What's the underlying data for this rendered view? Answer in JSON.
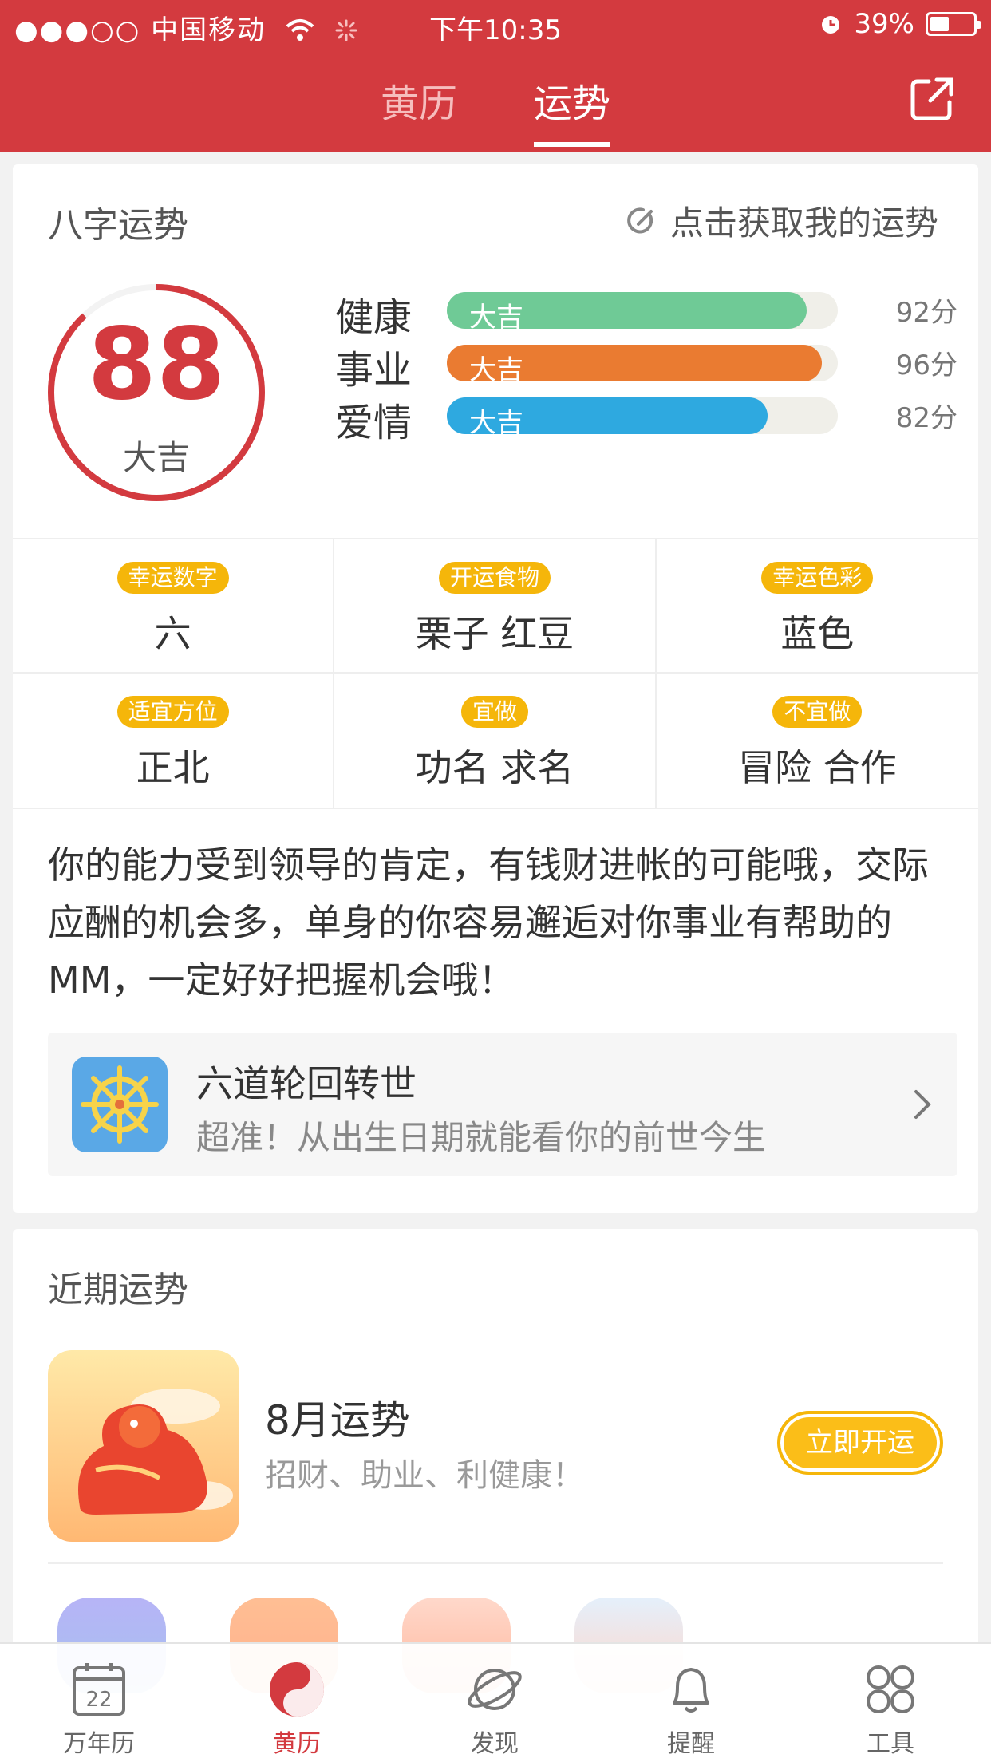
{
  "status_bar": {
    "signal": "●●●○○",
    "carrier": "中国移动",
    "time": "下午10:35",
    "battery": "39%",
    "battery_level": 0.39
  },
  "header": {
    "tabs": [
      {
        "label": "黄历",
        "active": false
      },
      {
        "label": "运势",
        "active": true
      }
    ]
  },
  "bazi": {
    "title": "八字运势",
    "get_label": "点击获取我的运势",
    "score": "88",
    "score_label": "大吉",
    "score_fraction": 0.88,
    "bars": [
      {
        "name": "健康",
        "tag": "大吉",
        "score": "92分",
        "value": 92,
        "color": "#6fca96"
      },
      {
        "name": "事业",
        "tag": "大吉",
        "score": "96分",
        "value": 96,
        "color": "#ea7b31"
      },
      {
        "name": "爱情",
        "tag": "大吉",
        "score": "82分",
        "value": 82,
        "color": "#2ea9e0"
      }
    ],
    "grid": [
      {
        "tag": "幸运数字",
        "value": "六"
      },
      {
        "tag": "开运食物",
        "value": "栗子 红豆"
      },
      {
        "tag": "幸运色彩",
        "value": "蓝色"
      },
      {
        "tag": "适宜方位",
        "value": "正北"
      },
      {
        "tag": "宜做",
        "value": "功名 求名"
      },
      {
        "tag": "不宜做",
        "value": "冒险 合作"
      }
    ],
    "description": "你的能力受到领导的肯定，有钱财进帐的可能哦，交际应酬的机会多，单身的你容易邂逅对你事业有帮助的MM，一定好好把握机会哦！",
    "promo": {
      "title": "六道轮回转世",
      "subtitle": "超准！从出生日期就能看你的前世今生"
    }
  },
  "recent": {
    "title": "近期运势",
    "month_title": "8月运势",
    "month_sub": "招财、助业、利健康！",
    "button": "立即开运"
  },
  "bottom_nav": {
    "items": [
      {
        "label": "万年历",
        "icon": "calendar-icon",
        "day": "22"
      },
      {
        "label": "黄历",
        "icon": "almanac-icon",
        "active": true
      },
      {
        "label": "发现",
        "icon": "planet-icon"
      },
      {
        "label": "提醒",
        "icon": "bell-icon"
      },
      {
        "label": "工具",
        "icon": "grid-icon"
      }
    ]
  }
}
